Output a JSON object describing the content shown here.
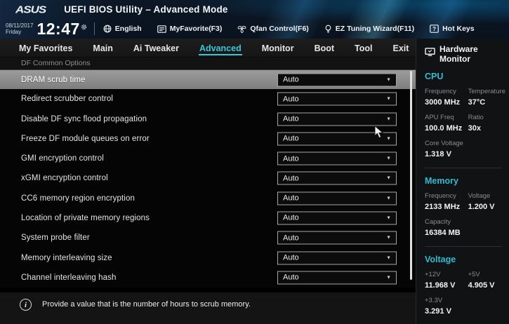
{
  "topbar": {
    "logo": "ASUS",
    "title": "UEFI BIOS Utility – Advanced Mode",
    "date": "08/11/2017",
    "day": "Friday",
    "time": "12:47",
    "toolbar": [
      {
        "icon": "globe-icon",
        "label": "English"
      },
      {
        "icon": "myfavorite-icon",
        "label": "MyFavorite(F3)"
      },
      {
        "icon": "fan-icon",
        "label": "Qfan Control(F6)"
      },
      {
        "icon": "bulb-icon",
        "label": "EZ Tuning Wizard(F11)"
      },
      {
        "icon": "question-icon",
        "label": "Hot Keys"
      }
    ]
  },
  "tabs": {
    "items": [
      "My Favorites",
      "Main",
      "Ai Tweaker",
      "Advanced",
      "Monitor",
      "Boot",
      "Tool",
      "Exit"
    ],
    "active_index": 3
  },
  "breadcrumb": "DF Common Options",
  "settings": {
    "rows": [
      {
        "label": "DRAM scrub time",
        "value": "Auto",
        "highlighted": true
      },
      {
        "label": "Redirect scrubber control",
        "value": "Auto",
        "highlighted": false
      },
      {
        "label": "Disable DF sync flood propagation",
        "value": "Auto",
        "highlighted": false
      },
      {
        "label": "Freeze DF module queues on error",
        "value": "Auto",
        "highlighted": false
      },
      {
        "label": "GMI encryption control",
        "value": "Auto",
        "highlighted": false
      },
      {
        "label": "xGMI encryption control",
        "value": "Auto",
        "highlighted": false
      },
      {
        "label": "CC6 memory region encryption",
        "value": "Auto",
        "highlighted": false
      },
      {
        "label": "Location of private memory regions",
        "value": "Auto",
        "highlighted": false
      },
      {
        "label": "System probe filter",
        "value": "Auto",
        "highlighted": false
      },
      {
        "label": "Memory interleaving size",
        "value": "Auto",
        "highlighted": false
      },
      {
        "label": "Channel interleaving hash",
        "value": "Auto",
        "highlighted": false
      }
    ]
  },
  "status_bar": {
    "icon": "info-icon",
    "text": "Provide a value that is the number of hours to scrub memory."
  },
  "hardware_monitor": {
    "title": "Hardware Monitor",
    "icon": "monitor-icon",
    "sections": [
      {
        "name": "CPU",
        "rows": [
          [
            {
              "label": "Frequency",
              "value": "3000 MHz"
            },
            {
              "label": "Temperature",
              "value": "37°C"
            }
          ],
          [
            {
              "label": "APU Freq",
              "value": "100.0 MHz"
            },
            {
              "label": "Ratio",
              "value": "30x"
            }
          ],
          [
            {
              "label": "Core Voltage",
              "value": "1.318 V"
            }
          ]
        ]
      },
      {
        "name": "Memory",
        "rows": [
          [
            {
              "label": "Frequency",
              "value": "2133 MHz"
            },
            {
              "label": "Voltage",
              "value": "1.200 V"
            }
          ],
          [
            {
              "label": "Capacity",
              "value": "16384 MB"
            }
          ]
        ]
      },
      {
        "name": "Voltage",
        "rows": [
          [
            {
              "label": "+12V",
              "value": "11.968 V"
            },
            {
              "label": "+5V",
              "value": "4.905 V"
            }
          ],
          [
            {
              "label": "+3.3V",
              "value": "3.291 V"
            }
          ]
        ]
      }
    ]
  },
  "colors": {
    "accent_cyan": "#3bc5da",
    "highlight_row": "#8d8d8d",
    "banner_navy": "#0a1420",
    "sidebar_bg": "#101214"
  }
}
